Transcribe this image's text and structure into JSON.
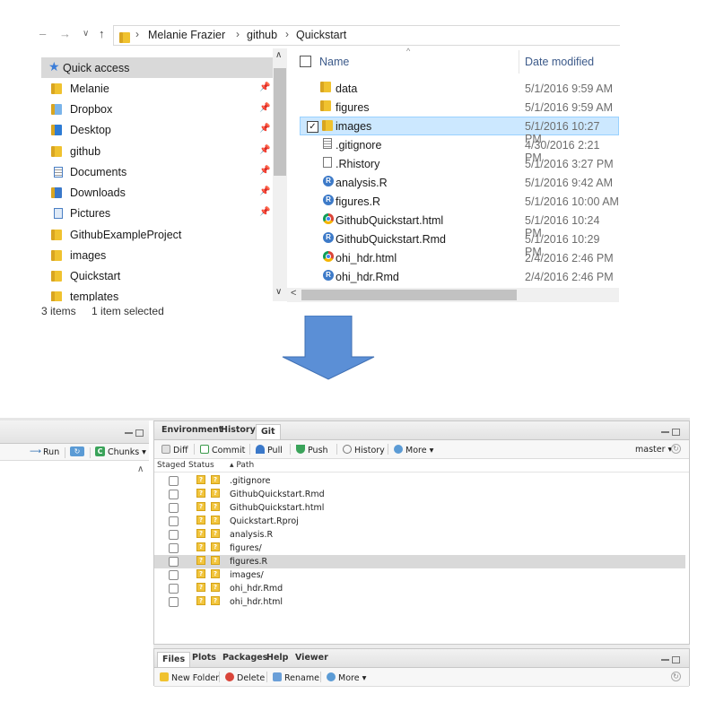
{
  "explorer": {
    "nav_buttons": {
      "back": "–",
      "forward": "→",
      "dropdown": "∨",
      "up": "↑"
    },
    "breadcrumb": [
      "Melanie Frazier",
      "github",
      "Quickstart"
    ],
    "nav_pane": {
      "quick_access": "Quick access",
      "items": [
        {
          "label": "Melanie",
          "icon": "folder-icon",
          "pinned": true
        },
        {
          "label": "Dropbox",
          "icon": "dropbox-icon",
          "pinned": true
        },
        {
          "label": "Desktop",
          "icon": "desktop-icon",
          "pinned": true
        },
        {
          "label": "github",
          "icon": "folder-icon",
          "pinned": true
        },
        {
          "label": "Documents",
          "icon": "documents-icon",
          "pinned": true
        },
        {
          "label": "Downloads",
          "icon": "downloads-icon",
          "pinned": true
        },
        {
          "label": "Pictures",
          "icon": "pictures-icon",
          "pinned": true
        },
        {
          "label": "GithubExampleProject",
          "icon": "folder-icon",
          "pinned": false
        },
        {
          "label": "images",
          "icon": "folder-icon",
          "pinned": false
        },
        {
          "label": "Quickstart",
          "icon": "folder-icon",
          "pinned": false
        },
        {
          "label": "templates",
          "icon": "folder-icon",
          "pinned": false
        }
      ]
    },
    "columns": {
      "name": "Name",
      "date": "Date modified"
    },
    "files": [
      {
        "name": "data",
        "date": "5/1/2016 9:59 AM",
        "type": "folder"
      },
      {
        "name": "figures",
        "date": "5/1/2016 9:59 AM",
        "type": "folder"
      },
      {
        "name": "images",
        "date": "5/1/2016 10:27 PM",
        "type": "folder",
        "selected": true
      },
      {
        "name": ".gitignore",
        "date": "4/30/2016 2:21 PM",
        "type": "text"
      },
      {
        "name": ".Rhistory",
        "date": "5/1/2016 3:27 PM",
        "type": "blank"
      },
      {
        "name": "analysis.R",
        "date": "5/1/2016 9:42 AM",
        "type": "r"
      },
      {
        "name": "figures.R",
        "date": "5/1/2016 10:00 AM",
        "type": "r"
      },
      {
        "name": "GithubQuickstart.html",
        "date": "5/1/2016 10:24 PM",
        "type": "chrome"
      },
      {
        "name": "GithubQuickstart.Rmd",
        "date": "5/1/2016 10:29 PM",
        "type": "r"
      },
      {
        "name": "ohi_hdr.html",
        "date": "2/4/2016 2:46 PM",
        "type": "chrome"
      },
      {
        "name": "ohi_hdr.Rmd",
        "date": "2/4/2016 2:46 PM",
        "type": "r"
      }
    ],
    "status": {
      "items": "3 items",
      "selected": "1 item selected"
    }
  },
  "rstudio": {
    "left_toolbar": {
      "run": "Run",
      "chunks": "Chunks ▾"
    },
    "git_pane": {
      "tabs": [
        "Environment",
        "History",
        "Git"
      ],
      "active_tab": "Git",
      "toolbar": {
        "diff": "Diff",
        "commit": "Commit",
        "pull": "Pull",
        "push": "Push",
        "history": "History",
        "more": "More ▾",
        "branch": "master ▾"
      },
      "columns": {
        "staged": "Staged",
        "status": "Status",
        "path": "▴ Path"
      },
      "rows": [
        {
          "path": ".gitignore"
        },
        {
          "path": "GithubQuickstart.Rmd"
        },
        {
          "path": "GithubQuickstart.html"
        },
        {
          "path": "Quickstart.Rproj"
        },
        {
          "path": "analysis.R"
        },
        {
          "path": "figures/"
        },
        {
          "path": "figures.R",
          "highlighted": true
        },
        {
          "path": "images/"
        },
        {
          "path": "ohi_hdr.Rmd"
        },
        {
          "path": "ohi_hdr.html"
        }
      ],
      "status_glyph": "?"
    },
    "files_pane": {
      "tabs": [
        "Files",
        "Plots",
        "Packages",
        "Help",
        "Viewer"
      ],
      "toolbar": {
        "new_folder": "New Folder",
        "delete": "Delete",
        "rename": "Rename",
        "more": "More ▾"
      }
    }
  },
  "colors": {
    "selection": "#cce8ff",
    "arrow": "#5b8fd6",
    "folder": "#f0c22f",
    "git_status": "#f2c53d"
  }
}
